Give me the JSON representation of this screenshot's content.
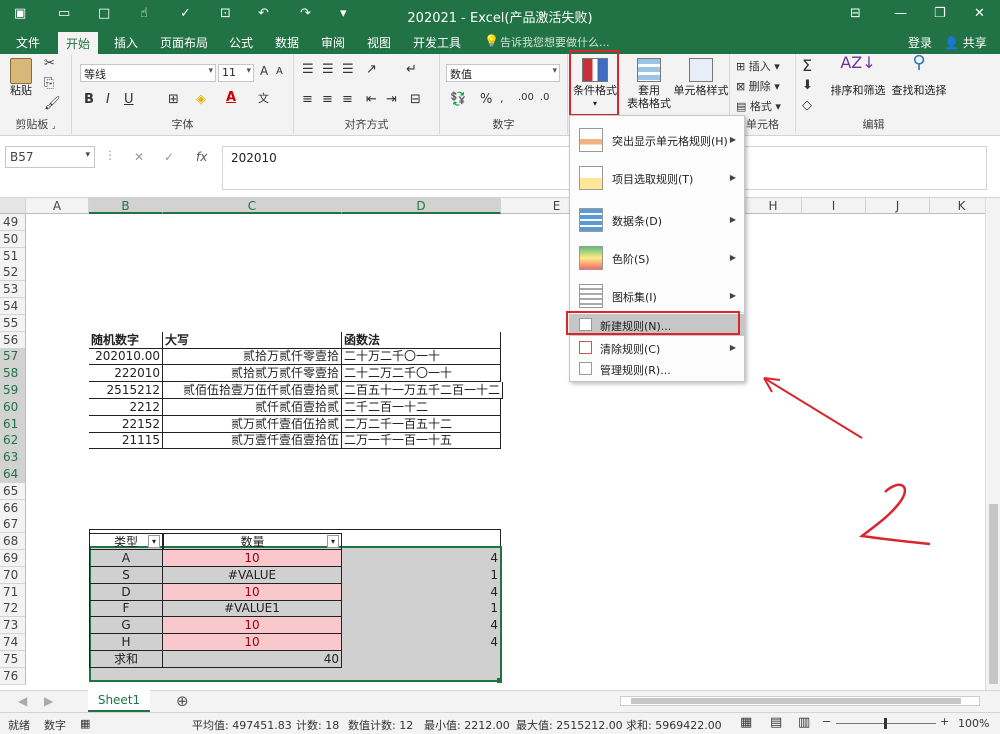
{
  "window": {
    "title": "202021 - Excel(产品激活失败)"
  },
  "tabs": [
    "文件",
    "开始",
    "插入",
    "页面布局",
    "公式",
    "数据",
    "审阅",
    "视图",
    "开发工具"
  ],
  "search_hint": "告诉我您想要做什么...",
  "account": {
    "login": "登录",
    "share": "共享"
  },
  "ribbon": {
    "clipboard": {
      "paste": "粘贴",
      "label": "剪贴板"
    },
    "font": {
      "name": "等线",
      "size": "11",
      "label": "字体",
      "bold": "B",
      "italic": "I",
      "underline": "U"
    },
    "alignment": {
      "label": "对齐方式"
    },
    "number": {
      "format": "数值",
      "label": "数字",
      "percent": "%"
    },
    "styles": {
      "conditional": "条件格式",
      "table_format_1": "套用",
      "table_format_2": "表格格式",
      "cell_styles": "单元格样式",
      "label": "单元格"
    },
    "cells": {
      "insert": "插入",
      "delete": "删除",
      "format": "格式"
    },
    "editing": {
      "sort": "排序和筛选",
      "find": "查找和选择",
      "label": "编辑",
      "sum": "Σ"
    }
  },
  "formula_bar": {
    "name_box": "B57",
    "fx": "fx",
    "value": "202010"
  },
  "columns": [
    "A",
    "B",
    "C",
    "D",
    "E",
    "H",
    "I",
    "J",
    "K"
  ],
  "rows": [
    "49",
    "50",
    "51",
    "52",
    "53",
    "54",
    "55",
    "56",
    "57",
    "58",
    "59",
    "60",
    "61",
    "62",
    "63",
    "64",
    "65",
    "66",
    "67",
    "68",
    "69",
    "70",
    "71",
    "72",
    "73",
    "74",
    "75",
    "76"
  ],
  "table1": {
    "headers": [
      "随机数字",
      "大写",
      "函数法"
    ],
    "rows": [
      [
        "202010.00",
        "贰拾万贰仟零壹拾",
        "二十万二千〇一十"
      ],
      [
        "222010",
        "贰拾贰万贰仟零壹拾",
        "二十二万二千〇一十"
      ],
      [
        "2515212",
        "贰佰伍拾壹万伍仟贰佰壹拾贰",
        "二百五十一万五千二百一十二"
      ],
      [
        "2212",
        "贰仟贰佰壹拾贰",
        "二千二百一十二"
      ],
      [
        "22152",
        "贰万贰仟壹佰伍拾贰",
        "二万二千一百五十二"
      ],
      [
        "21115",
        "贰万壹仟壹佰壹拾伍",
        "二万一千一百一十五"
      ]
    ]
  },
  "table2": {
    "headers": [
      "类型",
      "数量"
    ],
    "rows": [
      {
        "type": "A",
        "qty": "10",
        "e": "4"
      },
      {
        "type": "S",
        "qty": "#VALUE",
        "e": "1"
      },
      {
        "type": "D",
        "qty": "10",
        "e": "4"
      },
      {
        "type": "F",
        "qty": "#VALUE1",
        "e": "1"
      },
      {
        "type": "G",
        "qty": "10",
        "e": "4"
      },
      {
        "type": "H",
        "qty": "10",
        "e": "4"
      }
    ],
    "sum_label": "求和",
    "sum_value": "40",
    "highlight": "#f8c8cc",
    "highlight_text": "#9c0006"
  },
  "menu": {
    "items": [
      {
        "label": "突出显示单元格规则(H)"
      },
      {
        "label": "项目选取规则(T)"
      },
      {
        "label": "数据条(D)"
      },
      {
        "label": "色阶(S)"
      },
      {
        "label": "图标集(I)"
      },
      {
        "label": "新建规则(N)..."
      },
      {
        "label": "清除规则(C)"
      },
      {
        "label": "管理规则(R)..."
      }
    ]
  },
  "annotation": "2",
  "sheet_tab": "Sheet1",
  "status": {
    "ready": "就绪",
    "numlock": "数字",
    "avg": "平均值: 497451.83",
    "count": "计数: 18",
    "numcount": "数值计数: 12",
    "min": "最小值: 2212.00",
    "max": "最大值: 2515212.00",
    "sum": "求和: 5969422.00",
    "zoom": "100%"
  },
  "colors": {
    "excel_green": "#217346",
    "red": "#d9262c"
  }
}
